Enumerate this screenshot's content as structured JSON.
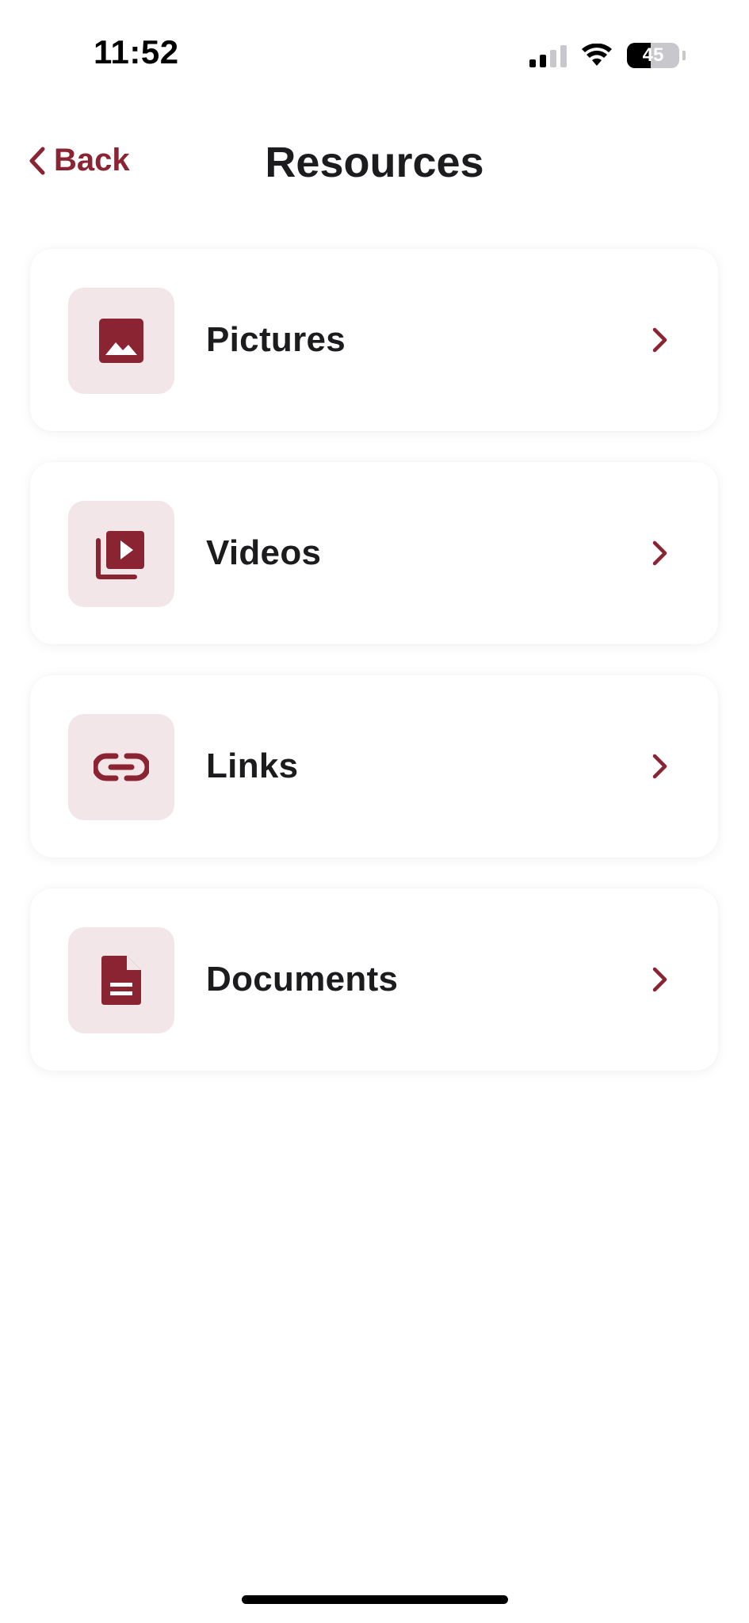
{
  "status_bar": {
    "time": "11:52",
    "battery_level": "45",
    "battery_fraction": 0.45,
    "signal_bars_active": 2,
    "signal_bars_total": 4
  },
  "nav": {
    "back_label": "Back",
    "title": "Resources"
  },
  "colors": {
    "accent": "#8a2432",
    "icon_background": "#f2e6e8",
    "card_background": "#ffffff",
    "text": "#1c1c1e"
  },
  "items": [
    {
      "label": "Pictures",
      "icon": "image-icon"
    },
    {
      "label": "Videos",
      "icon": "video-library-icon"
    },
    {
      "label": "Links",
      "icon": "link-icon"
    },
    {
      "label": "Documents",
      "icon": "document-icon"
    }
  ]
}
